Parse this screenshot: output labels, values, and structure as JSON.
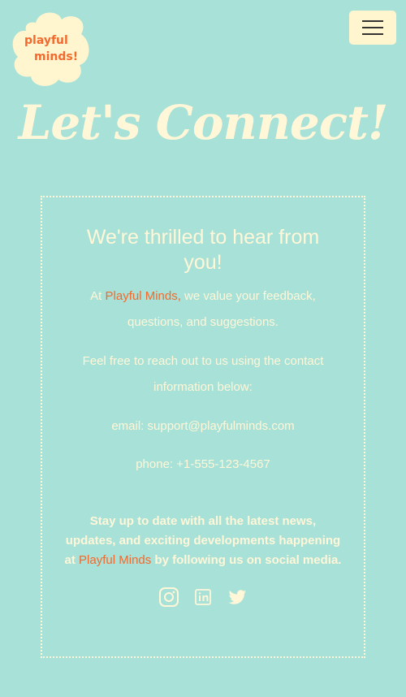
{
  "header": {
    "logo_line1": "playful",
    "logo_line2": "minds!",
    "menu_icon": "hamburger-icon"
  },
  "hero": {
    "title": "Let's Connect!"
  },
  "contact": {
    "heading": "We're thrilled to hear from you!",
    "intro_prefix": "At ",
    "brand": "Playful Minds,",
    "intro_suffix": " we value your feedback, questions, and suggestions.",
    "reach_text": "Feel free to reach out to us using the contact information below:",
    "email_label": "email: ",
    "email": "support@playfulminds.com",
    "phone_label": "phone: ",
    "phone": "+1-555-123-4567",
    "follow_prefix": "Stay up to date with all the latest news, updates, and exciting developments happening at ",
    "follow_brand": "Playful Minds",
    "follow_suffix": " by following us on social media."
  },
  "socials": [
    "instagram-icon",
    "linkedin-icon",
    "twitter-icon"
  ],
  "colors": {
    "background": "#a7e1d7",
    "cream": "#fff7d8",
    "accent": "#f26a2e"
  }
}
